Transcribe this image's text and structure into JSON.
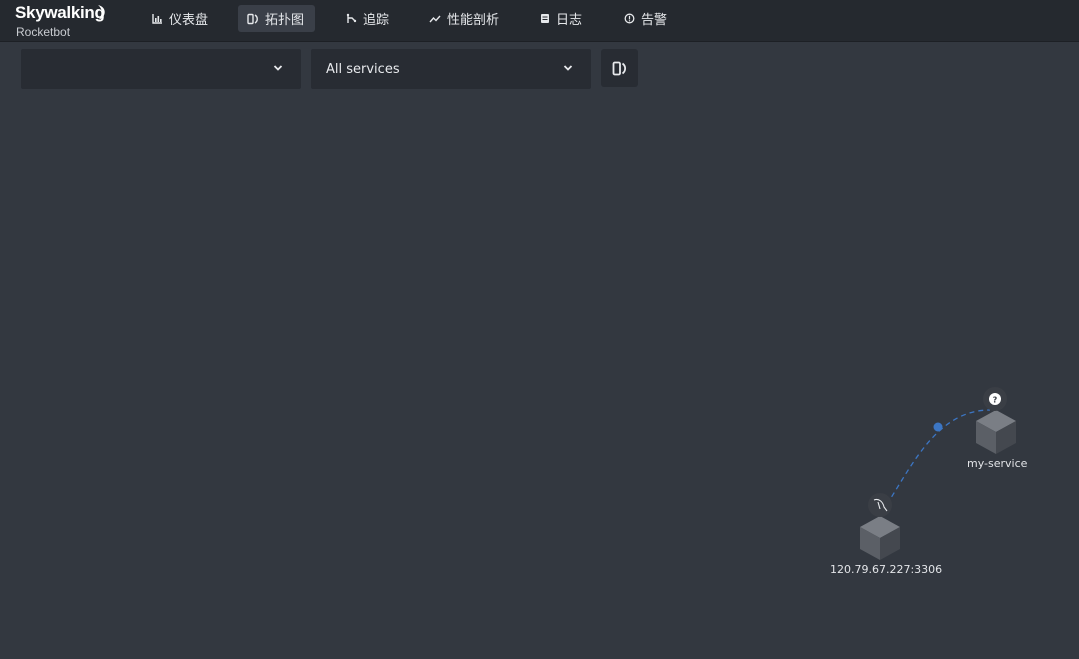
{
  "brand": {
    "name": "Skywalking",
    "subtitle": "Rocketbot"
  },
  "nav": [
    {
      "label": "仪表盘",
      "icon": "bar-chart-icon",
      "active": false
    },
    {
      "label": "拓扑图",
      "icon": "topology-icon",
      "active": true
    },
    {
      "label": "追踪",
      "icon": "trace-icon",
      "active": false
    },
    {
      "label": "性能剖析",
      "icon": "trend-line-icon",
      "active": false
    },
    {
      "label": "日志",
      "icon": "log-icon",
      "active": false
    },
    {
      "label": "告警",
      "icon": "alarm-icon",
      "active": false
    }
  ],
  "toolbar": {
    "group_select": {
      "value": ""
    },
    "service_select": {
      "value": "All services"
    },
    "layout_button": {
      "icon": "topology-icon"
    }
  },
  "topology": {
    "nodes": [
      {
        "label": "my-service",
        "icon": "question-mark-icon",
        "type": "unknown"
      },
      {
        "label": "120.79.67.227:3306",
        "icon": "mysql-dolphin-icon",
        "type": "database"
      }
    ],
    "edges": [
      {
        "from": "120.79.67.227:3306",
        "to": "my-service"
      }
    ]
  },
  "colors": {
    "background": "#333840",
    "topbar": "#25292f",
    "select_bg": "#282c33",
    "edge": "#3c76c4",
    "node": "#5b5f66"
  }
}
